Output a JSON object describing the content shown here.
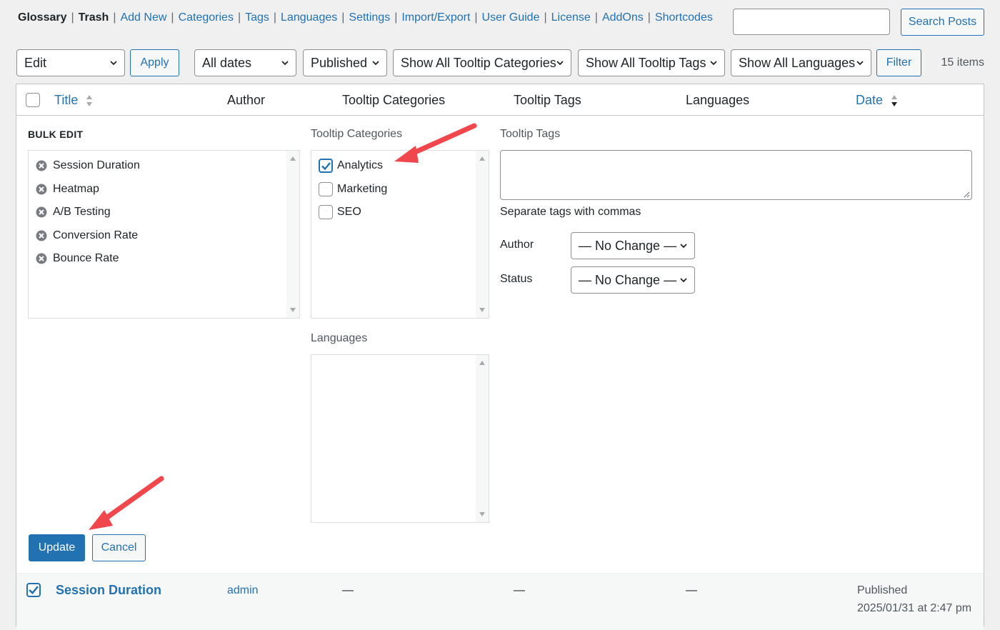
{
  "nav": {
    "items": [
      {
        "label": "Glossary",
        "current": true
      },
      {
        "label": "Trash",
        "current": true
      },
      {
        "label": "Add New"
      },
      {
        "label": "Categories"
      },
      {
        "label": "Tags"
      },
      {
        "label": "Languages"
      },
      {
        "label": "Settings"
      },
      {
        "label": "Import/Export"
      },
      {
        "label": "User Guide"
      },
      {
        "label": "License"
      },
      {
        "label": "AddOns"
      },
      {
        "label": "Shortcodes"
      }
    ],
    "separator": "|"
  },
  "search": {
    "value": "",
    "button_label": "Search Posts"
  },
  "filters": {
    "bulk_action": "Edit",
    "apply_label": "Apply",
    "dates": "All dates",
    "status": "Published",
    "categories": "Show All Tooltip Categories",
    "tags": "Show All Tooltip Tags",
    "languages": "Show All Languages",
    "filter_label": "Filter",
    "items_count": "15 items"
  },
  "table": {
    "columns": {
      "title": "Title",
      "author": "Author",
      "categories": "Tooltip Categories",
      "tags": "Tooltip Tags",
      "languages": "Languages",
      "date": "Date"
    }
  },
  "bulk_edit": {
    "heading": "BULK EDIT",
    "titles": [
      "Session Duration",
      "Heatmap",
      "A/B Testing",
      "Conversion Rate",
      "Bounce Rate"
    ],
    "categories_label": "Tooltip Categories",
    "categories": [
      {
        "label": "Analytics",
        "checked": true
      },
      {
        "label": "Marketing",
        "checked": false
      },
      {
        "label": "SEO",
        "checked": false
      }
    ],
    "languages_label": "Languages",
    "tags_label": "Tooltip Tags",
    "tags_value": "",
    "tags_hint": "Separate tags with commas",
    "author_label": "Author",
    "author_value": "— No Change —",
    "status_label": "Status",
    "status_value": "— No Change —",
    "update_label": "Update",
    "cancel_label": "Cancel"
  },
  "row": {
    "title": "Session Duration",
    "author": "admin",
    "categories": "—",
    "tags": "—",
    "languages": "—",
    "date_status": "Published",
    "date": "2025/01/31 at 2:47 pm",
    "checked": true
  },
  "colors": {
    "accent": "#2271b1",
    "annotation_arrow": "#f0474d",
    "background": "#f0f0f1"
  }
}
